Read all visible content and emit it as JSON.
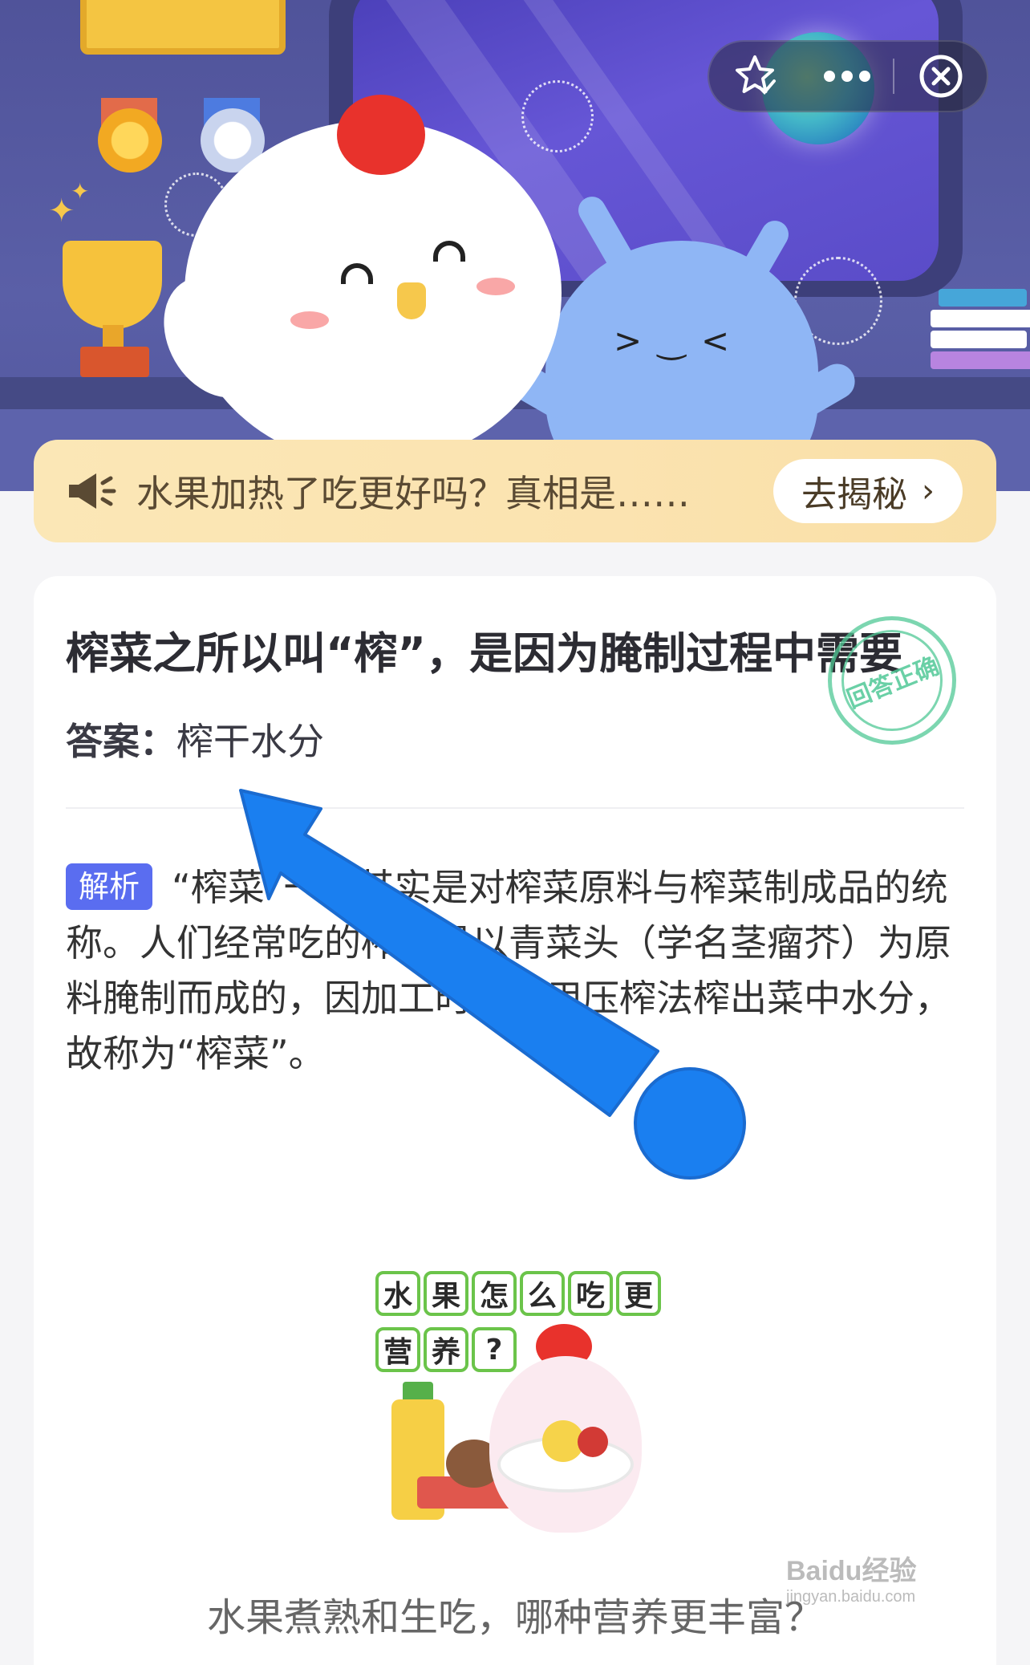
{
  "notice": {
    "text": "水果加热了吃更好吗？真相是……",
    "button_label": "去揭秘",
    "button_chevron": "›"
  },
  "question": {
    "title": "榨菜之所以叫“榨”，是因为腌制过程中需要",
    "stamp_text": "回答正确",
    "answer_label": "答案：",
    "answer_value": "榨干水分"
  },
  "analysis": {
    "tag": "解析",
    "text": "“榨菜”一词其实是对榨菜原料与榨菜制成品的统称。人们经常吃的榨菜是以青菜头（学名茎瘤芥）为原料腌制而成的，因加工时需要用压榨法榨出菜中水分，故称为“榨菜”。"
  },
  "illustration": {
    "tiles_row1": [
      "水",
      "果",
      "怎",
      "么",
      "吃",
      "更"
    ],
    "tiles_row2": [
      "营",
      "养",
      "?"
    ]
  },
  "caption": "水果煮熟和生吃，哪种营养更丰富？",
  "watermark": {
    "brand": "Baidu经验",
    "url": "jingyan.baidu.com"
  },
  "colors": {
    "accent": "#5a6df0",
    "notice_bg": "#fbe7b6",
    "tile_border": "#6bc44a",
    "overlay_arrow": "#1a7ff0"
  },
  "icons": {
    "favorite": "star-check-icon",
    "more": "more-dots-icon",
    "close": "close-circle-icon",
    "notice": "megaphone-icon"
  }
}
